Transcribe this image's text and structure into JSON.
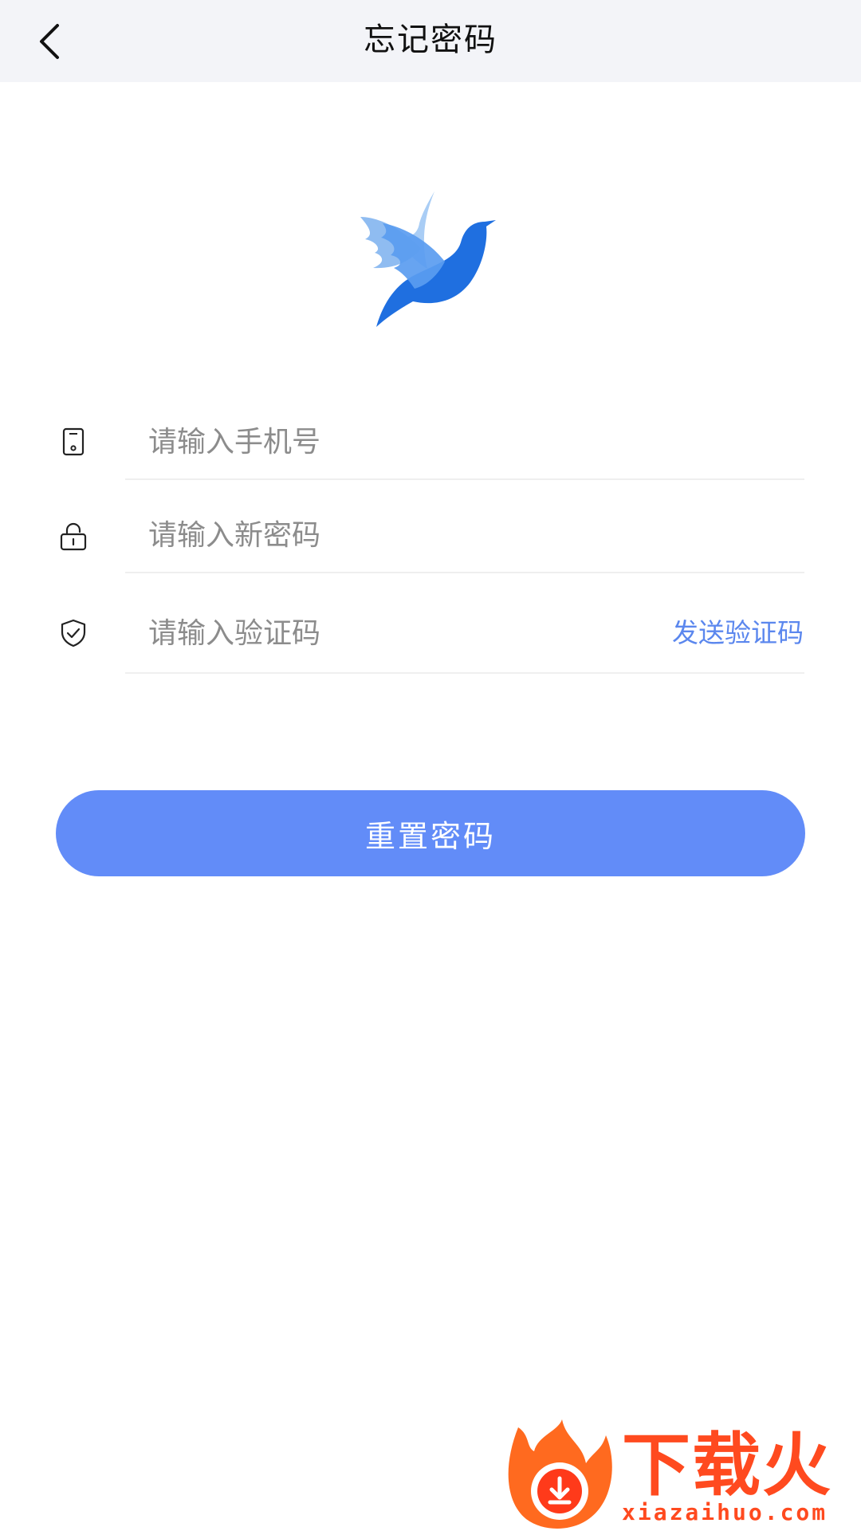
{
  "header": {
    "title": "忘记密码"
  },
  "form": {
    "phone_placeholder": "请输入手机号",
    "password_placeholder": "请输入新密码",
    "code_placeholder": "请输入验证码",
    "send_code_label": "发送验证码"
  },
  "actions": {
    "reset_label": "重置密码"
  },
  "watermark": {
    "brand": "下载火",
    "url": "xiazaihuo.com"
  },
  "colors": {
    "accent": "#628cf8",
    "link": "#5b87ee",
    "header_bg": "#f3f4f8",
    "watermark": "#ff4a1f"
  },
  "icons": [
    "back-chevron-icon",
    "bird-logo-icon",
    "phone-icon",
    "lock-icon",
    "shield-check-icon"
  ]
}
